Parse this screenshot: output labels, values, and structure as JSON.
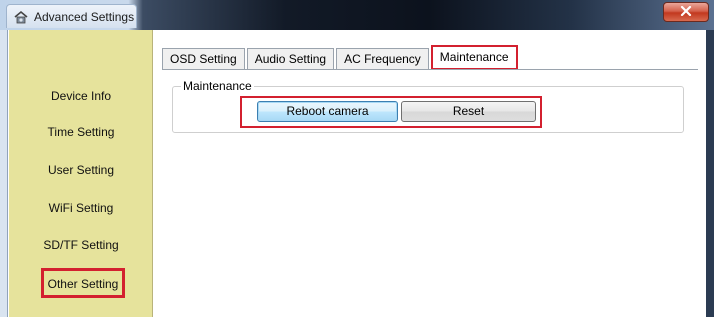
{
  "window": {
    "title": "Advanced Settings",
    "app_icon": "camera-house-icon",
    "close_icon": "close-icon"
  },
  "sidebar": {
    "items": [
      {
        "label": "Device Info"
      },
      {
        "label": "Time Setting"
      },
      {
        "label": "User Setting"
      },
      {
        "label": "WiFi Setting"
      },
      {
        "label": "SD/TF Setting"
      },
      {
        "label": "Other Setting",
        "highlighted": true
      }
    ]
  },
  "tabs": [
    {
      "label": "OSD Setting"
    },
    {
      "label": "Audio Setting"
    },
    {
      "label": "AC Frequency"
    },
    {
      "label": "Maintenance",
      "active": true
    }
  ],
  "maintenance": {
    "group_title": "Maintenance",
    "reboot_label": "Reboot camera",
    "reset_label": "Reset"
  },
  "colors": {
    "sidebar_bg": "#e6e39c",
    "highlight": "#d3202f"
  }
}
